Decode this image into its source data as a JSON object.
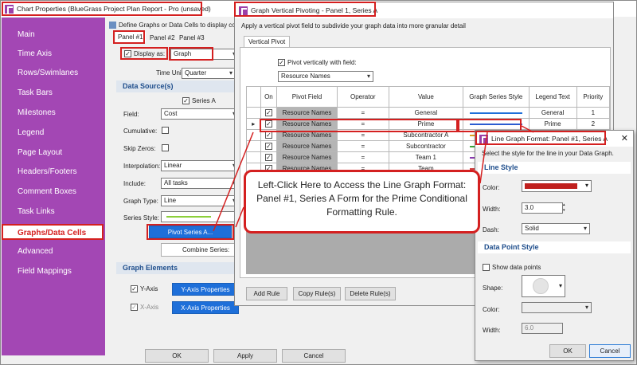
{
  "main_window": {
    "title": "Chart Properties (BlueGrass Project Plan Report - Pro (unsaved)",
    "define_text": "Define Graphs or Data Cells to display cos",
    "tabs": [
      "Panel #1",
      "Panel #2",
      "Panel #3"
    ],
    "display_as_label": "Display as:",
    "display_as_value": "Graph",
    "time_unit_label": "Time Unit:",
    "time_unit_value": "Quarter",
    "data_sources_header": "Data Source(s)",
    "series_a_label": "Series A",
    "field_label": "Field:",
    "field_value": "Cost",
    "cumulative_label": "Cumulative:",
    "skip_zeros_label": "Skip Zeros:",
    "interpolation_label": "Interpolation:",
    "interpolation_value": "Linear",
    "include_label": "Include:",
    "include_value": "All tasks",
    "graph_type_label": "Graph Type:",
    "graph_type_value": "Line",
    "series_style_label": "Series Style:",
    "pivot_series_button": "Pivot Series A...",
    "combine_series_button": "Combine Series:",
    "graph_elements_header": "Graph Elements",
    "y_axis_label": "Y-Axis",
    "x_axis_label": "X-Axis",
    "y_axis_props_button": "Y-Axis Properties",
    "x_axis_props_button": "X-Axis Properties",
    "ok_button": "OK",
    "apply_button": "Apply",
    "cancel_button": "Cancel"
  },
  "sidebar": {
    "items": [
      "Main",
      "Time Axis",
      "Rows/Swimlanes",
      "Task Bars",
      "Milestones",
      "Legend",
      "Page Layout",
      "Headers/Footers",
      "Comment Boxes",
      "Task Links",
      "Graphs/Data Cells",
      "Advanced",
      "Field Mappings"
    ],
    "active": "Graphs/Data Cells"
  },
  "pivot_window": {
    "title": "Graph Vertical Pivoting - Panel 1, Series A",
    "description": "Apply a vertical pivot field to subdivide your graph data into more granular detail",
    "tab": "Vertical Pivot",
    "pivot_checkbox_label": "Pivot vertically with field:",
    "pivot_field_value": "Resource Names",
    "columns": [
      "On",
      "Pivot Field",
      "Operator",
      "Value",
      "Graph Series Style",
      "Legend Text",
      "Priority"
    ],
    "rows": [
      {
        "field": "Resource Names",
        "operator": "=",
        "value": "General",
        "legend": "General",
        "priority": "1",
        "style_color": "#1e6fd9"
      },
      {
        "field": "Resource Names",
        "operator": "=",
        "value": "Prime",
        "legend": "Prime",
        "priority": "2",
        "style_color": "#2a5bd0"
      },
      {
        "field": "Resource Names",
        "operator": "=",
        "value": "Subcontractor A",
        "legend": "",
        "priority": "",
        "style_color": "#e0a020"
      },
      {
        "field": "Resource Names",
        "operator": "=",
        "value": "Subcontractor",
        "legend": "",
        "priority": "",
        "style_color": "#3aa43a"
      },
      {
        "field": "Resource Names",
        "operator": "=",
        "value": "Team 1",
        "legend": "",
        "priority": "",
        "style_color": "#8a3ab0"
      },
      {
        "field": "Resource Names",
        "operator": "=",
        "value": "Team",
        "legend": "",
        "priority": "",
        "style_color": "#d04040"
      }
    ],
    "add_rule": "Add Rule",
    "copy_rules": "Copy Rule(s)",
    "delete_rules": "Delete Rule(s)"
  },
  "line_format_window": {
    "title": "Line Graph Format: Panel #1, Series A",
    "description": "Select the style for the line in your Data Graph.",
    "line_style_header": "Line Style",
    "color_label": "Color:",
    "color_value": "#c0201e",
    "width_label": "Width:",
    "width_value": "3.0",
    "dash_label": "Dash:",
    "dash_value": "Solid",
    "data_point_header": "Data Point Style",
    "show_points_label": "Show data points",
    "shape_label": "Shape:",
    "point_color_label": "Color:",
    "point_width_label": "Width:",
    "point_width_value": "6.0",
    "ok_button": "OK",
    "cancel_button": "Cancel",
    "close_icon": "close-icon"
  },
  "callout": {
    "text": "Left-Click Here to Access the Line Graph Format: Panel #1, Series A Form for the Prime Conditional Formatting Rule."
  },
  "colors": {
    "sidebar": "#a347b4",
    "highlight_red": "#d42020",
    "accent_blue": "#1e6fd9"
  }
}
